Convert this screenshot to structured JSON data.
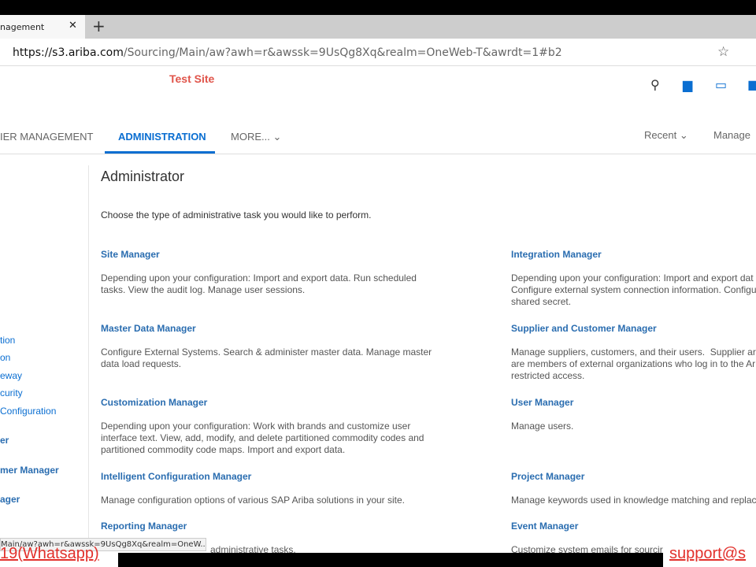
{
  "browser": {
    "tab_title": "nagement",
    "url_host": "https://s3.ariba.com",
    "url_path": "/Sourcing/Main/aw?awh=r&awssk=9UsQg8Xq&realm=OneWeb-T&awrdt=1#b2",
    "status_url": "Main/aw?awh=r&awssk=9UsQg8Xq&realm=OneW..."
  },
  "header": {
    "site_label": "Test Site",
    "site_color": "#e0544a",
    "icons": [
      "search-icon",
      "print-icon",
      "feedback-icon",
      "chat-icon"
    ]
  },
  "nav": {
    "items": [
      "IER MANAGEMENT",
      "ADMINISTRATION",
      "MORE..."
    ],
    "active": "ADMINISTRATION",
    "recent": "Recent",
    "manage": "Manage",
    "accent": "#0a6ed1"
  },
  "sidebar": {
    "items": [
      "tion",
      "on",
      "eway",
      "curity",
      "Configuration"
    ],
    "bold_items": [
      "er",
      "mer Manager",
      "ager"
    ]
  },
  "main": {
    "title": "Administrator",
    "intro": "Choose the type of administrative task you would like to perform.",
    "left": [
      {
        "title": "Site Manager",
        "desc": "Depending upon your configuration: Import and export data. Run scheduled\ntasks. View the audit log. Manage user sessions."
      },
      {
        "title": "Master Data Manager",
        "desc": "Configure External Systems. Search & administer master data. Manage master\ndata load requests."
      },
      {
        "title": "Customization Manager",
        "desc": "Depending upon your configuration: Work with brands and customize user\ninterface text. View, add, modify, and delete partitioned commodity codes and\npartitioned commodity code maps. Import and export data."
      },
      {
        "title": "Intelligent Configuration Manager",
        "desc": "Manage configuration options of various SAP Ariba solutions in your site."
      },
      {
        "title": "Reporting Manager",
        "desc": "administrative tasks."
      }
    ],
    "right": [
      {
        "title": "Integration Manager",
        "desc": "Depending upon your configuration: Import and export dat\nConfigure external system connection information. Configu\nshared secret."
      },
      {
        "title": "Supplier and Customer Manager",
        "desc": "Manage suppliers, customers, and their users.  Supplier ar\nare members of external organizations who log in to the Ar\nrestricted access."
      },
      {
        "title": "User Manager",
        "desc": "Manage users."
      },
      {
        "title": "Project Manager",
        "desc": "Manage keywords used in knowledge matching and replac"
      },
      {
        "title": "Event Manager",
        "desc": "Customize system emails for sourcir"
      }
    ]
  },
  "overlay": {
    "left_text": "19(Whatsapp)",
    "right_text": "support@s"
  }
}
